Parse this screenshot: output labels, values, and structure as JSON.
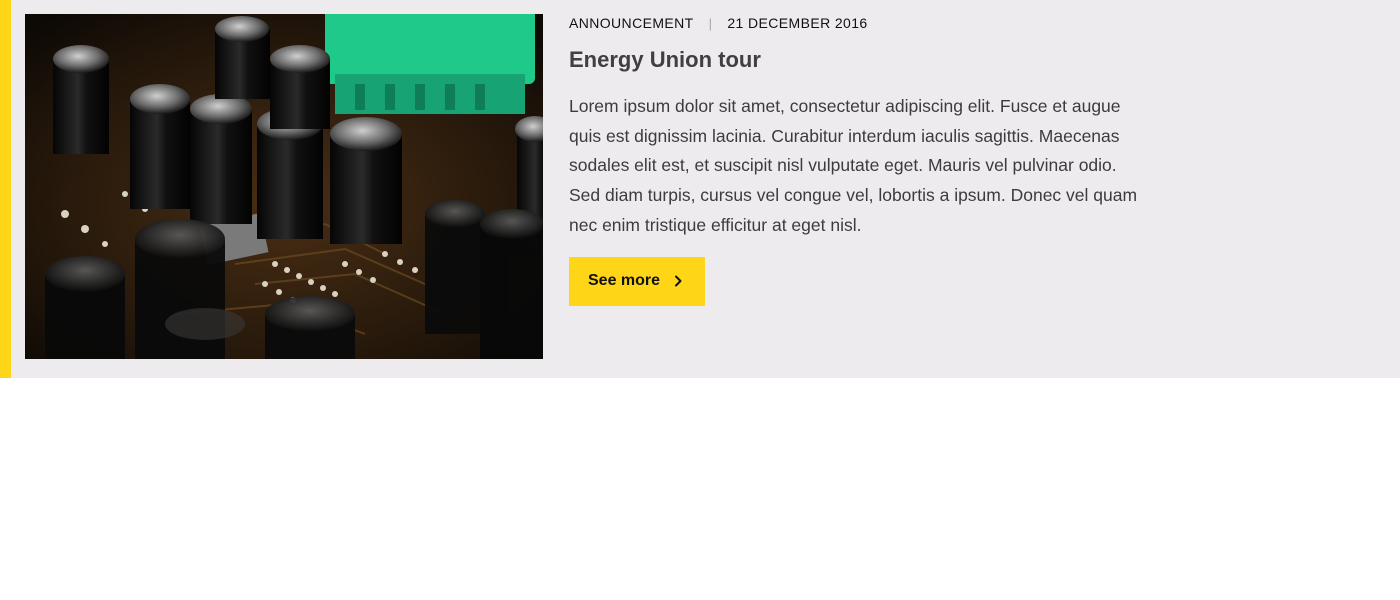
{
  "article": {
    "category": "ANNOUNCEMENT",
    "separator": "|",
    "date": "21 DECEMBER 2016",
    "title": "Energy Union tour",
    "body": "Lorem ipsum dolor sit amet, consectetur adipiscing elit. Fusce et augue quis est dignissim lacinia. Curabitur interdum iaculis sagittis. Maecenas sodales elit est, et suscipit nisl vulputate eget. Mauris vel pulvinar odio. Sed diam turpis, cursus vel congue vel, lobortis a ipsum. Donec vel quam nec enim tristique efficitur at eget nisl.",
    "cta_label": "See more",
    "cta_icon": "chevron-right-icon",
    "image_subject": "circuit board with capacitors"
  },
  "colors": {
    "accent": "#ffd617",
    "card_background": "#eeebee",
    "title": "#404040",
    "body": "#3c3c3c"
  }
}
